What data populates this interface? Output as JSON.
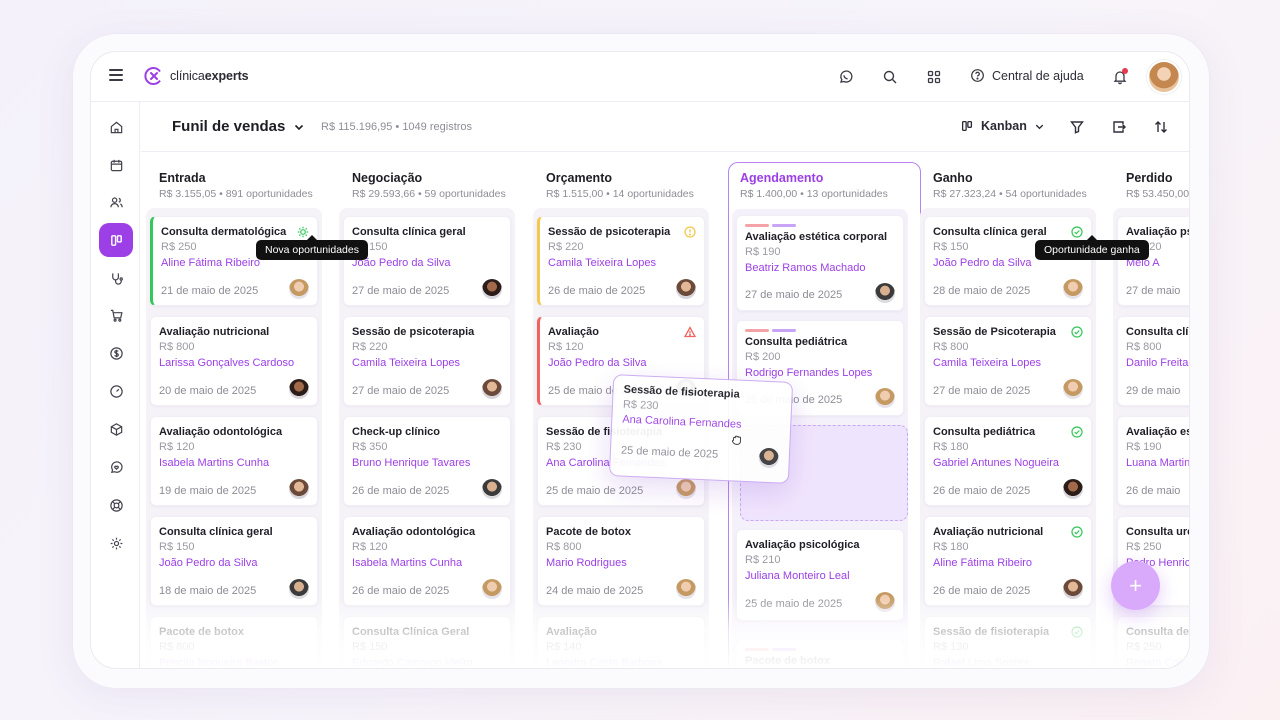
{
  "topbar": {
    "logo_prefix": "clínica",
    "logo_bold": "experts",
    "help_label": "Central de ajuda"
  },
  "toolbar": {
    "title": "Funil de vendas",
    "meta": "R$ 115.196,95 • 1049 registros",
    "view": "Kanban"
  },
  "colors": {
    "accent": "#9c3fe6",
    "success": "#34c759",
    "warning": "#f2c94c",
    "danger": "#ef6461"
  },
  "sidebar_icons": [
    "home-icon",
    "calendar-icon",
    "users-icon",
    "kanban-icon",
    "stethoscope-icon",
    "cart-icon",
    "dollar-icon",
    "gauge-icon",
    "box-icon",
    "heart-chat-icon",
    "support-icon",
    "settings-icon"
  ],
  "columns": [
    {
      "title": "Entrada",
      "sub": "R$ 3.155,05 • 891 oportunidades",
      "cards": [
        {
          "title": "Consulta dermatológica",
          "price": "R$ 250",
          "name": "Aline Fátima Ribeiro",
          "date": "21 de maio de 2025"
        },
        {
          "title": "Avaliação nutricional",
          "price": "R$ 800",
          "name": "Larissa Gonçalves Cardoso",
          "date": "20 de maio de 2025"
        },
        {
          "title": "Avaliação odontológica",
          "price": "R$ 120",
          "name": "Isabela Martins Cunha",
          "date": "19 de maio de 2025"
        },
        {
          "title": "Consulta clínica geral",
          "price": "R$ 150",
          "name": "João Pedro da Silva",
          "date": "18 de maio de 2025"
        },
        {
          "title": "Pacote de botox",
          "price": "R$ 800",
          "name": "Priscila Nogueira Bastos",
          "date": ""
        }
      ]
    },
    {
      "title": "Negociação",
      "sub": "R$ 29.593,66 • 59 oportunidades",
      "cards": [
        {
          "title": "Consulta clínica geral",
          "price": "R$ 150",
          "name": "João Pedro da Silva",
          "date": "27 de maio de 2025"
        },
        {
          "title": "Sessão de psicoterapia",
          "price": "R$ 220",
          "name": "Camila Teixeira Lopes",
          "date": "27 de maio de 2025"
        },
        {
          "title": "Check-up clínico",
          "price": "R$ 350",
          "name": "Bruno Henrique Tavares",
          "date": "26 de maio de 2025"
        },
        {
          "title": "Avaliação odontológica",
          "price": "R$ 120",
          "name": "Isabela Martins Cunha",
          "date": "26 de maio de 2025"
        },
        {
          "title": "Consulta Clínica Geral",
          "price": "R$ 150",
          "name": "Eduardo Camargo Vieira",
          "date": ""
        }
      ]
    },
    {
      "title": "Orçamento",
      "sub": "R$ 1.515,00 • 14 oportunidades",
      "cards": [
        {
          "title": "Sessão de psicoterapia",
          "price": "R$ 220",
          "name": "Camila Teixeira Lopes",
          "date": "26 de maio de 2025"
        },
        {
          "title": "Avaliação",
          "price": "R$ 120",
          "name": "João Pedro da Silva",
          "date": "25 de maio de 2025"
        },
        {
          "title": "Sessão de fisioterapia",
          "price": "R$ 230",
          "name": "Ana Carolina Fernandes",
          "date": "25 de maio de 2025"
        },
        {
          "title": "Pacote de botox",
          "price": "R$ 800",
          "name": "Mario Rodrigues",
          "date": "24 de maio de 2025"
        },
        {
          "title": "Avaliação",
          "price": "R$ 140",
          "name": "Leandra Costa Barbosa",
          "date": ""
        }
      ]
    },
    {
      "title": "Agendamento",
      "sub": "R$ 1.400,00 • 13 oportunidades",
      "cards": [
        {
          "title": "Avaliação estética corporal",
          "price": "R$ 190",
          "name": "Beatriz Ramos Machado",
          "date": "27 de maio de 2025"
        },
        {
          "title": "Consulta pediátrica",
          "price": "R$ 200",
          "name": "Rodrigo Fernandes Lopes",
          "date": "25 de maio de 2025"
        },
        {
          "title": "Avaliação psicológica",
          "price": "R$ 210",
          "name": "Juliana Monteiro Leal",
          "date": "25 de maio de 2025"
        },
        {
          "title": "Pacote de botox",
          "price": "",
          "name": "",
          "date": ""
        }
      ]
    },
    {
      "title": "Ganho",
      "sub": "R$ 27.323,24 • 54 oportunidades",
      "cards": [
        {
          "title": "Consulta clínica geral",
          "price": "R$ 150",
          "name": "João Pedro da Silva",
          "date": "28 de maio de 2025"
        },
        {
          "title": "Sessão de Psicoterapia",
          "price": "R$ 800",
          "name": "Camila Teixeira Lopes",
          "date": "27 de maio de 2025"
        },
        {
          "title": "Consulta pediátrica",
          "price": "R$ 180",
          "name": "Gabriel Antunes Nogueira",
          "date": "26 de maio de 2025"
        },
        {
          "title": "Avaliação nutricional",
          "price": "R$ 180",
          "name": "Aline Fátima Ribeiro",
          "date": "26 de maio de 2025"
        },
        {
          "title": "Sessão de fisioterapia",
          "price": "R$ 130",
          "name": "Rafael Lima Soares",
          "date": ""
        }
      ]
    },
    {
      "title": "Perdido",
      "sub": "R$ 53.450,00",
      "cards": [
        {
          "title": "Avaliação ps",
          "price": "R$ 220",
          "name": "Melo A",
          "date": "27 de maio"
        },
        {
          "title": "Consulta clín",
          "price": "R$ 800",
          "name": "Danilo Freita",
          "date": "29 de maio"
        },
        {
          "title": "Avaliação es",
          "price": "R$ 190",
          "name": "Luana Martin",
          "date": "26 de maio"
        },
        {
          "title": "Consulta urc",
          "price": "R$ 250",
          "name": "Pedro Henric",
          "date": ""
        },
        {
          "title": "Consulta der",
          "price": "R$ 250",
          "name": "Renata Colu",
          "date": ""
        }
      ]
    }
  ],
  "drag_card": {
    "title": "Sessão de fisioterapia",
    "price": "R$ 230",
    "name": "Ana Carolina Fernandes",
    "date": "25 de maio de 2025"
  },
  "tooltips": {
    "new": "Nova oportunidades",
    "won": "Oportunidade ganha"
  },
  "fab_label": "+"
}
